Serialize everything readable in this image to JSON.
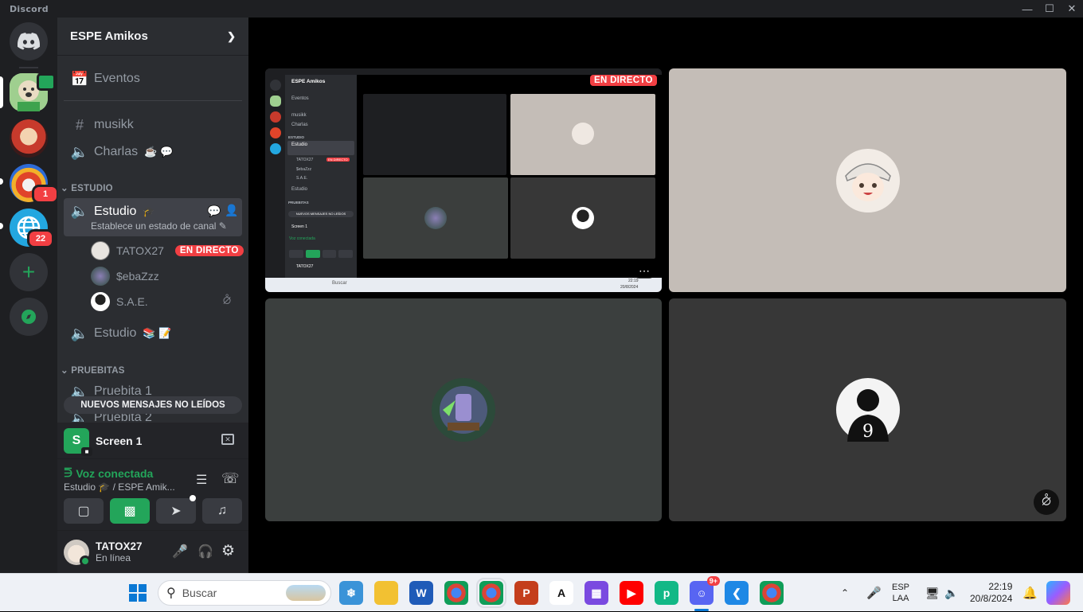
{
  "window": {
    "title": "Discord"
  },
  "guilds": [
    {
      "badge": ""
    },
    {
      "badge": ""
    },
    {
      "badge": "1"
    },
    {
      "badge": "22"
    }
  ],
  "server": {
    "name": "ESPE Amikos"
  },
  "channels": {
    "events": "Eventos",
    "musikk": "musikk",
    "charlas": "Charlas",
    "cat_estudio": "ESTUDIO",
    "estudio": "Estudio",
    "estudio_status": "Establece un estado de canal",
    "estudio2": "Estudio",
    "cat_pruebitas": "PRUEBITAS",
    "pruebita1": "Pruebita 1",
    "pruebita2": "Pruebita 2"
  },
  "voice_users": [
    {
      "name": "TATOX27",
      "live": "EN DIRECTO"
    },
    {
      "name": "$ebaZzz"
    },
    {
      "name": "S.A.E."
    }
  ],
  "new_messages": "NUEVOS MENSAJES NO LEÍDOS",
  "screen_share": {
    "letter": "S",
    "title": "Screen 1"
  },
  "voice": {
    "status": "Voz conectada",
    "channel": "Estudio",
    "server_suffix": "/ ESPE Amik..."
  },
  "user": {
    "name": "TATOX27",
    "status": "En línea"
  },
  "stream": {
    "live": "EN DIRECTO"
  },
  "nested": {
    "server": "ESPE Amikos",
    "eventos": "Eventos",
    "musikk": "musikk",
    "charlas": "Charlas",
    "estudio_cat": "ESTUDIO",
    "estudio": "Estudio",
    "u1": "TATOX27",
    "u2": "$ebaZzz",
    "u3": "S.A.E.",
    "live": "EN DIRECTO",
    "estudio2": "Estudio",
    "prueb_cat": "PRUEBITAS",
    "newmsg": "NUEVOS MENSAJES NO LEÍDOS",
    "screen": "Screen 1",
    "voice": "Voz conectada",
    "user": "TATOX27",
    "search": "Buscar",
    "time": "22:19",
    "date": "20/8/2024"
  },
  "taskbar": {
    "search_placeholder": "Buscar",
    "discord_badge": "9+",
    "lang1": "ESP",
    "lang2": "LAA",
    "time": "22:19",
    "date": "20/8/2024"
  },
  "colors": {
    "accent": "#5865f2",
    "green": "#23a55a",
    "red": "#f23f43",
    "sidebar": "#2b2d31",
    "rail": "#1e1f22"
  }
}
